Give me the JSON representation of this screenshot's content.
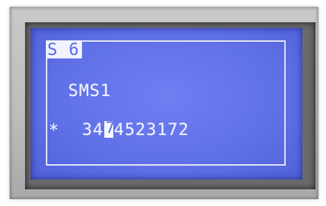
{
  "display": {
    "header": "S 6",
    "message_label": "SMS1",
    "marker": "*",
    "number_before_cursor": "34",
    "cursor_char": "7",
    "number_after_cursor": "4523172"
  },
  "colors": {
    "lcd_background": "#6474ea",
    "lcd_text": "#eef1ff",
    "bezel": "#bdbdbd"
  }
}
